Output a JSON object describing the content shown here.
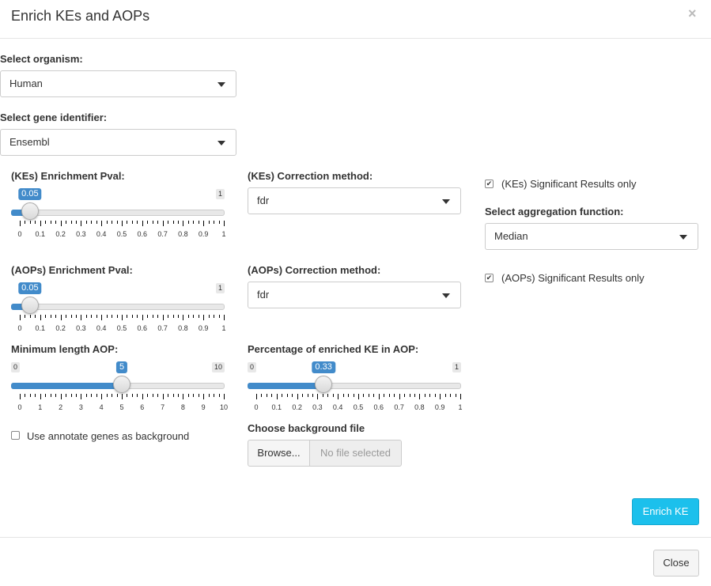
{
  "modal": {
    "title": "Enrich KEs and AOPs",
    "close_symbol": "×"
  },
  "organism": {
    "label": "Select organism:",
    "value": "Human"
  },
  "gene_identifier": {
    "label": "Select gene identifier:",
    "value": "Ensembl"
  },
  "kes_pval": {
    "label": "(KEs) Enrichment Pval:",
    "min": 0,
    "max": 1,
    "value": 0.05,
    "value_label": "0.05",
    "max_label": "1",
    "ticks": [
      "0",
      "0.1",
      "0.2",
      "0.3",
      "0.4",
      "0.5",
      "0.6",
      "0.7",
      "0.8",
      "0.9",
      "1"
    ]
  },
  "kes_correction": {
    "label": "(KEs) Correction method:",
    "value": "fdr"
  },
  "kes_significant": {
    "label": "(KEs) Significant Results only",
    "checked": true,
    "check_glyph": "✔"
  },
  "aggregation": {
    "label": "Select aggregation function:",
    "value": "Median"
  },
  "aops_pval": {
    "label": "(AOPs) Enrichment Pval:",
    "min": 0,
    "max": 1,
    "value": 0.05,
    "value_label": "0.05",
    "max_label": "1",
    "ticks": [
      "0",
      "0.1",
      "0.2",
      "0.3",
      "0.4",
      "0.5",
      "0.6",
      "0.7",
      "0.8",
      "0.9",
      "1"
    ]
  },
  "aops_correction": {
    "label": "(AOPs) Correction method:",
    "value": "fdr"
  },
  "aops_significant": {
    "label": "(AOPs) Significant Results only",
    "checked": true,
    "check_glyph": "✔"
  },
  "min_length": {
    "label": "Minimum length AOP:",
    "min": 0,
    "max": 10,
    "value": 5,
    "value_label": "5",
    "min_label": "0",
    "max_label": "10",
    "ticks": [
      "0",
      "1",
      "2",
      "3",
      "4",
      "5",
      "6",
      "7",
      "8",
      "9",
      "10"
    ]
  },
  "pct_enriched": {
    "label": "Percentage of enriched KE in AOP:",
    "min": 0,
    "max": 1,
    "value": 0.33,
    "value_label": "0.33",
    "min_label": "0",
    "max_label": "1",
    "ticks": [
      "0",
      "0.1",
      "0.2",
      "0.3",
      "0.4",
      "0.5",
      "0.6",
      "0.7",
      "0.8",
      "0.9",
      "1"
    ]
  },
  "background": {
    "label": "Use annotate genes as background",
    "checked": false
  },
  "background_file": {
    "label": "Choose background file",
    "browse": "Browse...",
    "status": "No file selected"
  },
  "buttons": {
    "enrich": "Enrich KE",
    "close": "Close"
  },
  "colors": {
    "accent": "#428bca",
    "enrich_button": "#1cc0ec"
  }
}
